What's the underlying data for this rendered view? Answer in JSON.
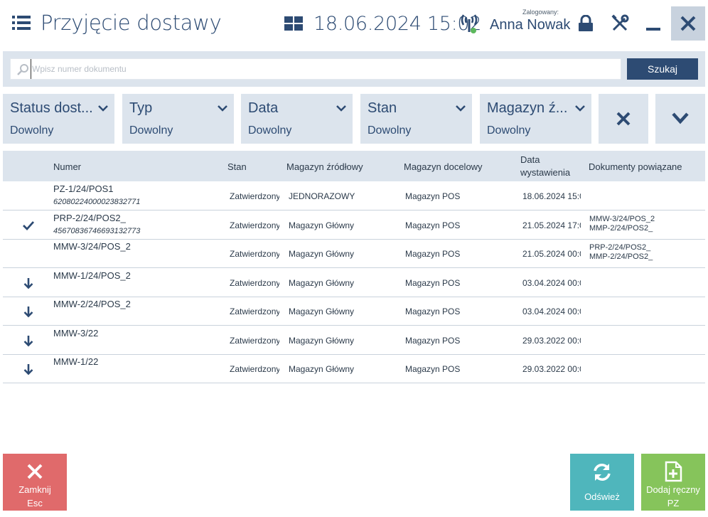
{
  "header": {
    "title": "Przyjęcie dostawy",
    "datetime": "18.06.2024 15:02",
    "logged_label": "Zalogowany:",
    "user_name": "Anna Nowak"
  },
  "search": {
    "placeholder": "Wpisz numer dokumentu",
    "value": "",
    "button_label": "Szukaj"
  },
  "filters": [
    {
      "label": "Status dost...",
      "value": "Dowolny"
    },
    {
      "label": "Typ",
      "value": "Dowolny"
    },
    {
      "label": "Data",
      "value": "Dowolny"
    },
    {
      "label": "Stan",
      "value": "Dowolny"
    },
    {
      "label": "Magazyn ź...",
      "value": "Dowolny"
    }
  ],
  "table": {
    "headers": {
      "numer": "Numer",
      "stan": "Stan",
      "mag_zrodlowy": "Magazyn źródłowy",
      "mag_docelowy": "Magazyn docelowy",
      "data_line1": "Data",
      "data_line2": "wystawienia",
      "dokumenty": "Dokumenty powiązane"
    },
    "rows": [
      {
        "icon": "none",
        "numer": "PZ-1/24/POS1",
        "numer_sub": "62080224000023832771",
        "stan": "Zatwierdzony",
        "mag_zrodlowy": "JEDNORAZOWY",
        "mag_docelowy": "Magazyn POS",
        "data": "18.06.2024 15:0",
        "rel1": "",
        "rel2": ""
      },
      {
        "icon": "check-icon",
        "numer": "PRP-2/24/POS2_",
        "numer_sub": "45670836746693132773",
        "stan": "Zatwierdzony",
        "mag_zrodlowy": "Magazyn Główny",
        "mag_docelowy": "Magazyn POS",
        "data": "21.05.2024 17:0",
        "rel1": "MMW-3/24/POS_2",
        "rel2": "MMP-2/24/POS2_"
      },
      {
        "icon": "none",
        "numer": "MMW-3/24/POS_2",
        "numer_sub": "",
        "stan": "Zatwierdzony",
        "mag_zrodlowy": "Magazyn Główny",
        "mag_docelowy": "Magazyn POS",
        "data": "21.05.2024 00:0",
        "rel1": "PRP-2/24/POS2_",
        "rel2": "MMP-2/24/POS2_"
      },
      {
        "icon": "arrow-down-icon",
        "numer": "MMW-1/24/POS_2",
        "numer_sub": "",
        "stan": "Zatwierdzony",
        "mag_zrodlowy": "Magazyn Główny",
        "mag_docelowy": "Magazyn POS",
        "data": "03.04.2024 00:0",
        "rel1": "",
        "rel2": ""
      },
      {
        "icon": "arrow-down-icon",
        "numer": "MMW-2/24/POS_2",
        "numer_sub": "",
        "stan": "Zatwierdzony",
        "mag_zrodlowy": "Magazyn Główny",
        "mag_docelowy": "Magazyn POS",
        "data": "03.04.2024 00:0",
        "rel1": "",
        "rel2": ""
      },
      {
        "icon": "arrow-down-icon",
        "numer": "MMW-3/22",
        "numer_sub": "",
        "stan": "Zatwierdzony",
        "mag_zrodlowy": "Magazyn Główny",
        "mag_docelowy": "Magazyn POS",
        "data": "29.03.2022 00:0",
        "rel1": "",
        "rel2": ""
      },
      {
        "icon": "arrow-down-icon",
        "numer": "MMW-1/22",
        "numer_sub": "",
        "stan": "Zatwierdzony",
        "mag_zrodlowy": "Magazyn Główny",
        "mag_docelowy": "Magazyn POS",
        "data": "29.03.2022 00:0",
        "rel1": "",
        "rel2": ""
      }
    ]
  },
  "footer": {
    "close_line1": "Zamknij",
    "close_line2": "Esc",
    "refresh": "Odśwież",
    "add_line1": "Dodaj ręczny",
    "add_line2": "PZ"
  },
  "colors": {
    "primary": "#2d4b73",
    "panel": "#dce4ed",
    "close": "#e06a6b",
    "refresh": "#4fb6bc",
    "add": "#86c45b",
    "status_green": "#5cb85c"
  }
}
